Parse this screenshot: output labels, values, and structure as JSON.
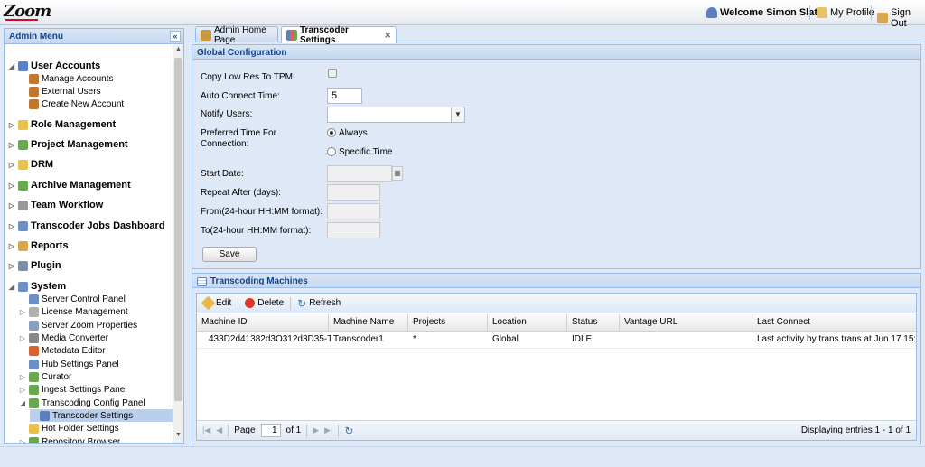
{
  "app": {
    "logo_text": "Zoom"
  },
  "topbar": {
    "welcome": "Welcome Simon Slate",
    "my_profile": "My Profile",
    "sign_out": "Sign Out"
  },
  "left_menu": {
    "title": "Admin Menu",
    "collapse_glyph": "«",
    "items": [
      {
        "label": "User Accounts",
        "icon": "users-icon",
        "level": 0,
        "expanded": true
      },
      {
        "label": "Manage Accounts",
        "icon": "user-icon",
        "level": 1
      },
      {
        "label": "External Users",
        "icon": "user-icon",
        "level": 1
      },
      {
        "label": "Create New Account",
        "icon": "user-add-icon",
        "level": 1
      },
      {
        "label": "Role Management",
        "icon": "shield-icon",
        "level": 0
      },
      {
        "label": "Project Management",
        "icon": "pie-icon",
        "level": 0
      },
      {
        "label": "DRM",
        "icon": "folder-icon",
        "level": 0
      },
      {
        "label": "Archive Management",
        "icon": "archive-icon",
        "level": 0
      },
      {
        "label": "Team Workflow",
        "icon": "workflow-icon",
        "level": 0
      },
      {
        "label": "Transcoder Jobs Dashboard",
        "icon": "monitor-icon",
        "level": 0
      },
      {
        "label": "Reports",
        "icon": "reports-icon",
        "level": 0
      },
      {
        "label": "Plugin",
        "icon": "plugin-icon",
        "level": 0
      },
      {
        "label": "System",
        "icon": "monitor-icon",
        "level": 0,
        "expanded": true
      },
      {
        "label": "Server Control Panel",
        "icon": "monitor-icon",
        "level": 1
      },
      {
        "label": "License Management",
        "icon": "license-icon",
        "level": 1
      },
      {
        "label": "Server Zoom Properties",
        "icon": "properties-icon",
        "level": 1
      },
      {
        "label": "Media Converter",
        "icon": "media-icon",
        "level": 1
      },
      {
        "label": "Metadata Editor",
        "icon": "metadata-icon",
        "level": 1
      },
      {
        "label": "Hub Settings Panel",
        "icon": "monitor-icon",
        "level": 1
      },
      {
        "label": "Curator",
        "icon": "tree-icon",
        "level": 1
      },
      {
        "label": "Ingest Settings Panel",
        "icon": "tree-icon",
        "level": 1
      },
      {
        "label": "Transcoding Config Panel",
        "icon": "tree-icon",
        "level": 1,
        "expanded": true
      },
      {
        "label": "Transcoder Settings",
        "icon": "chart-icon",
        "level": 2,
        "selected": true
      },
      {
        "label": "Hot Folder Settings",
        "icon": "folder-icon",
        "level": 1
      },
      {
        "label": "Repository Browser",
        "icon": "tree-icon",
        "level": 1
      }
    ]
  },
  "tabs": [
    {
      "label": "Admin Home Page",
      "icon": "home-icon"
    },
    {
      "label": "Transcoder Settings",
      "icon": "chart-icon",
      "active": true
    }
  ],
  "global_config": {
    "title": "Global Configuration",
    "copy_low_res_label": "Copy Low Res To TPM:",
    "auto_connect_label": "Auto Connect Time:",
    "auto_connect_value": "5",
    "notify_users_label": "Notify Users:",
    "notify_users_value": "",
    "preferred_time_label": "Preferred Time For Connection:",
    "radio_always": "Always",
    "radio_specific": "Specific Time",
    "start_date_label": "Start Date:",
    "repeat_after_label": "Repeat After (days):",
    "from_label": "From(24-hour HH:MM format):",
    "to_label": "To(24-hour HH:MM format):",
    "save_label": "Save"
  },
  "machines": {
    "title": "Transcoding Machines",
    "toolbar": {
      "edit": "Edit",
      "delete": "Delete",
      "refresh": "Refresh"
    },
    "columns": [
      "Machine ID",
      "Machine Name",
      "Projects",
      "Location",
      "Status",
      "Vantage URL",
      "Last Connect"
    ],
    "rows": [
      [
        "433D2d41382d3O312d3D35-Tr...",
        "Transcoder1",
        "*",
        "Global",
        "IDLE",
        "",
        "Last activity by trans trans at Jun 17 15:..."
      ]
    ],
    "paging": {
      "page_label": "Page",
      "page_value": "1",
      "of_label": "of 1",
      "display_info": "Displaying entries 1 - 1 of 1"
    }
  },
  "colors": {
    "accent": "#15428b",
    "panel_border": "#99bbe8",
    "background": "#dfe8f6"
  }
}
